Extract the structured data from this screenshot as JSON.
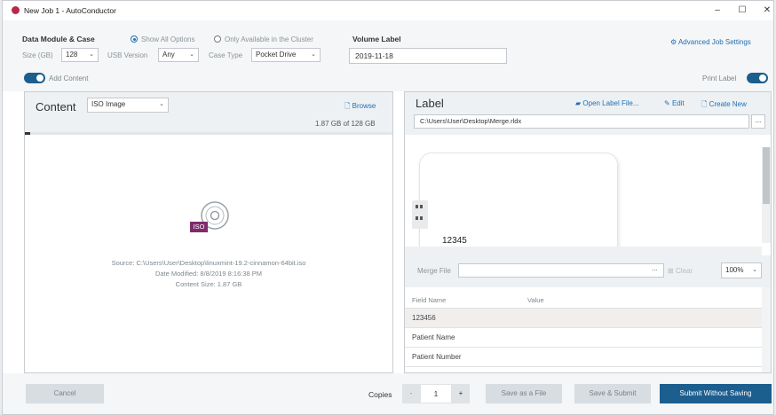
{
  "window": {
    "title": "New Job 1 - AutoConductor",
    "min": "–",
    "max": "☐",
    "close": "✕"
  },
  "data_module": {
    "heading": "Data Module & Case",
    "show_all": "Show All Options",
    "only_available": "Only Available in the Cluster",
    "size_label": "Size (GB)",
    "size_value": "128",
    "usb_label": "USB Version",
    "usb_value": "Any",
    "case_label": "Case Type",
    "case_value": "Pocket Drive"
  },
  "volume": {
    "heading": "Volume Label",
    "value": "2019-11-18"
  },
  "advanced": {
    "label": "Advanced Job Settings"
  },
  "add_content": {
    "label": "Add Content",
    "on": true
  },
  "print_label": {
    "label": "Print Label",
    "on": true
  },
  "content": {
    "title": "Content",
    "type_value": "ISO Image",
    "browse": "Browse",
    "capacity": "1.87 GB of 128 GB",
    "progress": 0.015,
    "iso_badge": "ISO",
    "source": "Source: C:\\Users\\User\\Desktop\\linuxmint-19.2-cinnamon-64bit.iso",
    "modified": "Date Modified: 8/8/2019 8:16:38 PM",
    "size": "Content Size: 1.87 GB"
  },
  "label": {
    "title": "Label",
    "open_file": "Open Label File...",
    "edit": "Edit",
    "create_new": "Create New",
    "path": "C:\\Users\\User\\Desktop\\Merge.rldx",
    "path_btn": "...",
    "preview_text": "12345",
    "merge_file_label": "Merge File",
    "merge_btn": "...",
    "clear": "Clear",
    "zoom": "100%",
    "columns": [
      "Field Name",
      "Value"
    ],
    "rows": [
      "123456",
      "Patient Name",
      "Patient Number"
    ]
  },
  "footer": {
    "cancel": "Cancel",
    "copies_label": "Copies",
    "minus": "-",
    "copies_value": "1",
    "plus": "+",
    "save_as_file": "Save as a File",
    "save_submit": "Save & Submit",
    "submit_without": "Submit Without Saving"
  }
}
